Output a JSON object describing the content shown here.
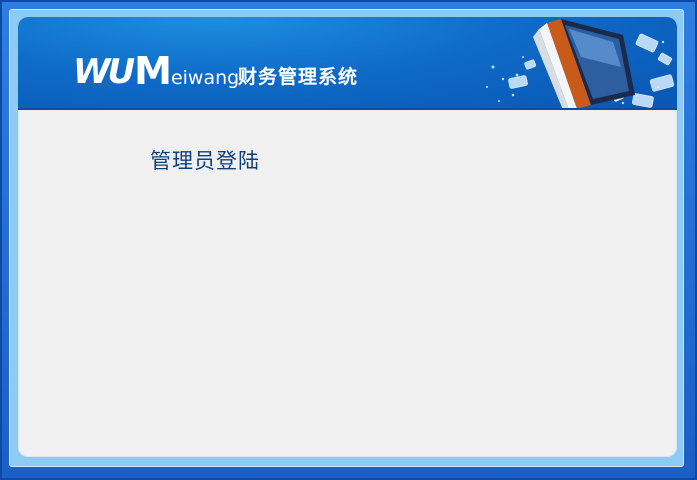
{
  "header": {
    "logo_prefix": "WU",
    "logo_m": "M",
    "logo_suffix": "eiwang",
    "system_title": "财务管理系统"
  },
  "main": {
    "login_title": "管理员登陆"
  },
  "colors": {
    "header_blue": "#0f6cc8",
    "frame_blue": "#1b5fc4",
    "panel_bg": "#f0f0f0",
    "title_text": "#0f3f7a"
  },
  "icons": [
    "laptop-illustration-icon"
  ]
}
